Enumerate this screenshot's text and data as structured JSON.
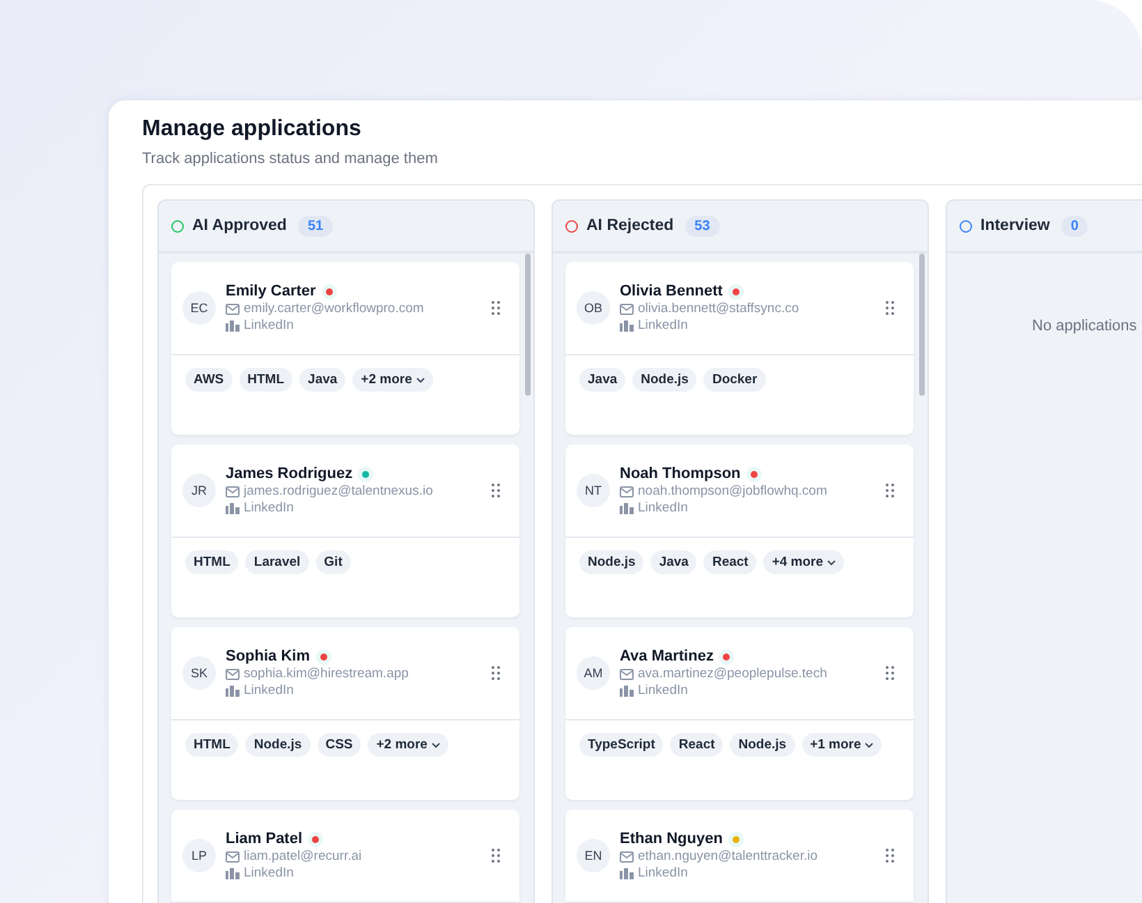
{
  "page": {
    "title": "Manage applications",
    "subtitle": "Track applications status and manage them"
  },
  "columns": [
    {
      "title": "AI Approved",
      "count": "51",
      "color": "#22c55e",
      "cards": [
        {
          "initials": "EC",
          "name": "Emily Carter",
          "color": "#ef4444",
          "email": "emily.carter@workflowpro.com",
          "source": "LinkedIn",
          "tags": [
            "AWS",
            "HTML",
            "Java"
          ],
          "more": "+2 more"
        },
        {
          "initials": "JR",
          "name": "James Rodriguez",
          "color": "#14b8a6",
          "email": "james.rodriguez@talentnexus.io",
          "source": "LinkedIn",
          "tags": [
            "HTML",
            "Laravel",
            "Git"
          ]
        },
        {
          "initials": "SK",
          "name": "Sophia Kim",
          "color": "#ef4444",
          "email": "sophia.kim@hirestream.app",
          "source": "LinkedIn",
          "tags": [
            "HTML",
            "Node.js",
            "CSS"
          ],
          "more": "+2 more"
        },
        {
          "initials": "LP",
          "name": "Liam Patel",
          "color": "#ef4444",
          "email": "liam.patel@recurr.ai",
          "source": "LinkedIn"
        }
      ]
    },
    {
      "title": "AI Rejected",
      "count": "53",
      "color": "#ef4444",
      "cards": [
        {
          "initials": "OB",
          "name": "Olivia Bennett",
          "color": "#ef4444",
          "email": "olivia.bennett@staffsync.co",
          "source": "LinkedIn",
          "tags": [
            "Java",
            "Node.js",
            "Docker"
          ]
        },
        {
          "initials": "NT",
          "name": "Noah Thompson",
          "color": "#ef4444",
          "email": "noah.thompson@jobflowhq.com",
          "source": "LinkedIn",
          "tags": [
            "Node.js",
            "Java",
            "React"
          ],
          "more": "+4 more"
        },
        {
          "initials": "AM",
          "name": "Ava Martinez",
          "color": "#ef4444",
          "email": "ava.martinez@peoplepulse.tech",
          "source": "LinkedIn",
          "tags": [
            "TypeScript",
            "React",
            "Node.js"
          ],
          "more": "+1 more"
        },
        {
          "initials": "EN",
          "name": "Ethan Nguyen",
          "color": "#eab308",
          "email": "ethan.nguyen@talenttracker.io",
          "source": "LinkedIn"
        }
      ]
    },
    {
      "title": "Interview",
      "count": "0",
      "color": "#3b82f6",
      "empty_text": "No applications"
    }
  ]
}
